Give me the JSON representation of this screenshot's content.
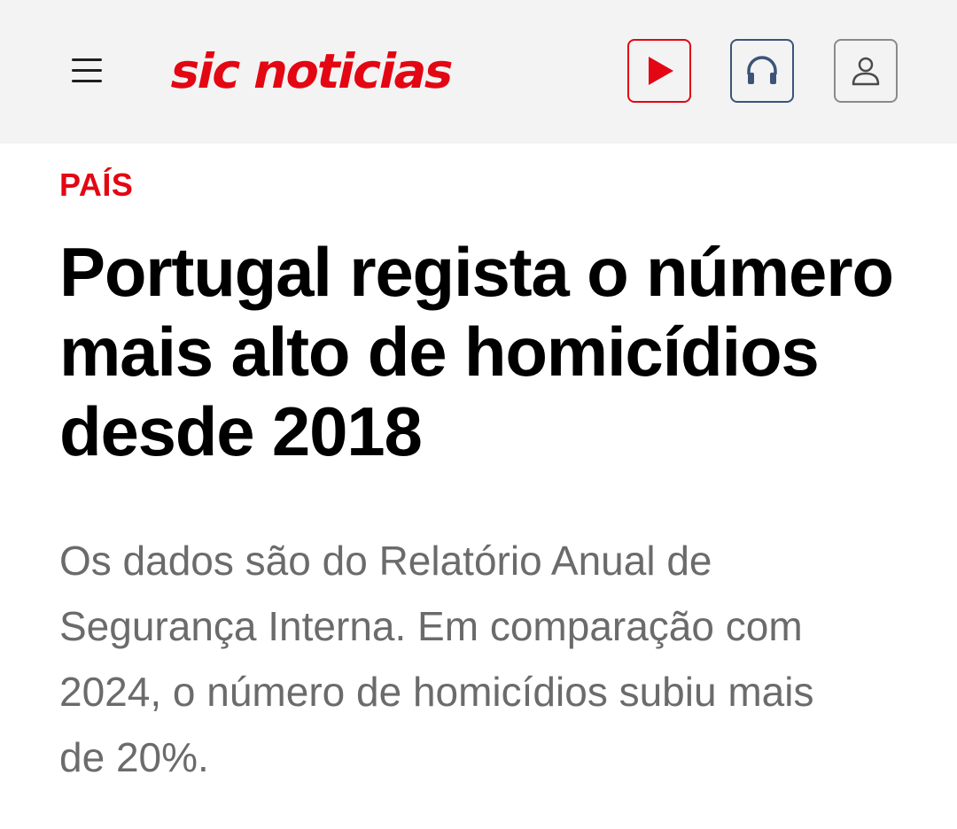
{
  "header": {
    "logo_text": "sic noticias",
    "menu_icon": "hamburger-menu-icon",
    "buttons": {
      "play": {
        "icon": "play-icon",
        "color": "#e30613"
      },
      "audio": {
        "icon": "headphones-icon",
        "color": "#3b5478"
      },
      "user": {
        "icon": "user-icon",
        "color": "#4a4a4a"
      }
    },
    "background": "#f3f3f3"
  },
  "article": {
    "section": "PAÍS",
    "title": "Portugal regista o número mais alto de homicídios desde 2018",
    "lead": "Os dados são do Relatório Anual de Segurança Interna. Em comparação com 2024, o número de homicídios subiu mais de 20%."
  },
  "colors": {
    "brand_red": "#e30613",
    "title": "#000000",
    "lead": "#6b6b6b"
  }
}
